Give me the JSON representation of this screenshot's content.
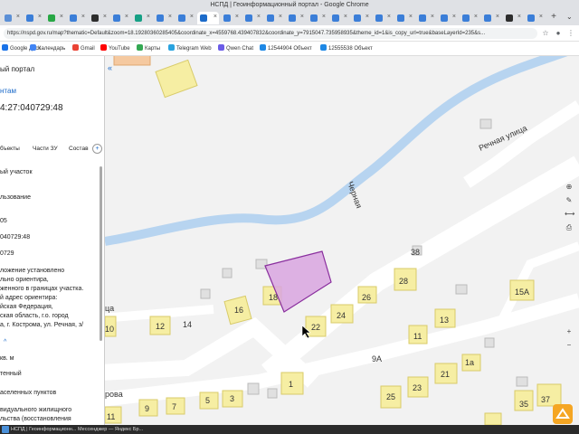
{
  "window": {
    "title": "НСПД | Геоинформационный портал - Google Chrome"
  },
  "tabs": {
    "new_tab": "+",
    "search": "⌄"
  },
  "address_bar": {
    "url": "https://nspd.gov.ru/map?thematic=Default&zoom=18.19280360285405&coordinate_x=4559768.439407832&coordinate_y=7915047.735958935&theme_id=1&is_copy_url=true&baseLayerId=235&s..."
  },
  "bookmarks": [
    {
      "label": "Google Диск",
      "color": "#1a73e8"
    },
    {
      "label": "Календарь",
      "color": "#4285f4"
    },
    {
      "label": "Gmail",
      "color": "#ea4335"
    },
    {
      "label": "YouTube",
      "color": "#ff0000"
    },
    {
      "label": "Карты",
      "color": "#34a853"
    },
    {
      "label": "Telegram Web",
      "color": "#2aa3df"
    },
    {
      "label": "Qwen Chat",
      "color": "#6b5ce7"
    },
    {
      "label": "12544904 Объект",
      "color": "#1e88e5"
    },
    {
      "label": "12555538 Объект",
      "color": "#1e88e5"
    }
  ],
  "sidebar": {
    "title": "ый портал",
    "link": "нтам",
    "cadastral": "4:27:040729:48",
    "tabs": [
      "бъекты",
      "Части ЗУ",
      "Состав"
    ],
    "add_tab": "+",
    "fields": [
      "ый участок",
      "льзование",
      "05",
      "040729:48",
      "0729"
    ],
    "address_block": [
      "ложение установлено",
      "льно ориентира,",
      "женного в границах участка.",
      "й адрес ориентира:",
      "йская Федерация,",
      "ская область, г.о. город",
      "а, г. Кострома, ул. Речная, з/"
    ],
    "chevron": "^",
    "lower_fields": [
      "кв. м",
      "тенный",
      "аселенных пунктов",
      "видуального жилищного",
      "льства (восстановления"
    ]
  },
  "map": {
    "street_label_1": "Речная улица",
    "river_label": "Черная",
    "street_label_2": "ца",
    "street_label_3": "рова",
    "buildings": [
      "38",
      "28",
      "15А",
      "16",
      "18",
      "26",
      "24",
      "22",
      "13",
      "12",
      "14",
      "10",
      "11",
      "9А",
      "23",
      "21",
      "1а",
      "25",
      "35",
      "37",
      "1",
      "3",
      "5",
      "7",
      "9",
      "11"
    ]
  },
  "taskbar": {
    "items": [
      "НСПД | Геоинформационн...",
      "Мессенджер — Яндекс Бр..."
    ]
  },
  "colors": {
    "river": "#b7d4f0",
    "parcel_fill": "#d9a6e0",
    "parcel_stroke": "#8a2f9e",
    "building": "#f6eea3",
    "building_stroke": "#d8cb6a",
    "accent": "#1b6ac9"
  }
}
